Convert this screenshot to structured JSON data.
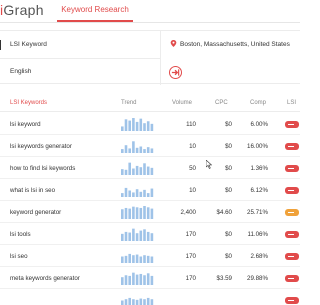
{
  "header": {
    "logo_prefix": "i",
    "logo_text": "Graph",
    "tab_active": "Keyword Research"
  },
  "search": {
    "keyword_value": "LSI Keyword",
    "language_value": "English",
    "location_value": "Boston, Massachusetts, United States"
  },
  "table": {
    "headers": {
      "keyword": "LSI Keywords",
      "trend": "Trend",
      "volume": "Volume",
      "cpc": "CPC",
      "comp": "Comp",
      "lsi": "LSI"
    },
    "rows": [
      {
        "keyword": "lsi keyword",
        "volume": "110",
        "cpc": "$0",
        "comp": "6.00%",
        "badge": "red",
        "trend": [
          0.35,
          0.9,
          0.8,
          1.0,
          0.7,
          0.95,
          0.6,
          0.75,
          0.55
        ]
      },
      {
        "keyword": "lsi keywords generator",
        "volume": "10",
        "cpc": "$0",
        "comp": "16.00%",
        "badge": "red",
        "trend": [
          0.3,
          0.6,
          0.35,
          0.9,
          0.4,
          0.5,
          0.3,
          0.45,
          0.35
        ]
      },
      {
        "keyword": "how to find lsi keywords",
        "volume": "50",
        "cpc": "$0",
        "comp": "1.36%",
        "badge": "red",
        "trend": [
          0.45,
          0.4,
          0.95,
          0.5,
          0.7,
          0.6,
          0.9,
          0.65,
          0.55
        ]
      },
      {
        "keyword": "what is lsi in seo",
        "volume": "10",
        "cpc": "$0",
        "comp": "6.12%",
        "badge": "red",
        "trend": [
          0.3,
          0.7,
          0.5,
          0.35,
          0.6,
          0.4,
          0.55,
          0.3,
          0.65
        ]
      },
      {
        "keyword": "keyword generator",
        "volume": "2,400",
        "cpc": "$4.60",
        "comp": "25.71%",
        "badge": "orange",
        "trend": [
          0.75,
          0.85,
          0.8,
          0.95,
          0.9,
          0.85,
          1.0,
          0.9,
          0.8
        ]
      },
      {
        "keyword": "lsi tools",
        "volume": "170",
        "cpc": "$0",
        "comp": "11.06%",
        "badge": "red",
        "trend": [
          0.55,
          0.7,
          0.65,
          0.95,
          0.6,
          0.8,
          0.9,
          0.7,
          0.6
        ]
      },
      {
        "keyword": "lsi seo",
        "volume": "170",
        "cpc": "$0",
        "comp": "2.68%",
        "badge": "red",
        "trend": [
          0.5,
          0.55,
          0.7,
          0.6,
          0.65,
          0.5,
          0.6,
          0.55,
          0.5
        ]
      },
      {
        "keyword": "meta keywords generator",
        "volume": "170",
        "cpc": "$3.59",
        "comp": "29.88%",
        "badge": "red",
        "trend": [
          0.6,
          0.75,
          0.7,
          0.95,
          0.8,
          0.85,
          0.75,
          0.9,
          0.7
        ]
      },
      {
        "keyword": "",
        "volume": "",
        "cpc": "",
        "comp": "",
        "badge": "red",
        "trend": [
          0.5,
          0.6,
          0.7,
          0.6,
          0.55,
          0.65,
          0.6,
          0.7,
          0.6
        ]
      }
    ]
  },
  "colors": {
    "accent": "#e14b4b",
    "trend_bar": "#9fc3e8",
    "badge_orange": "#f0a23a"
  }
}
